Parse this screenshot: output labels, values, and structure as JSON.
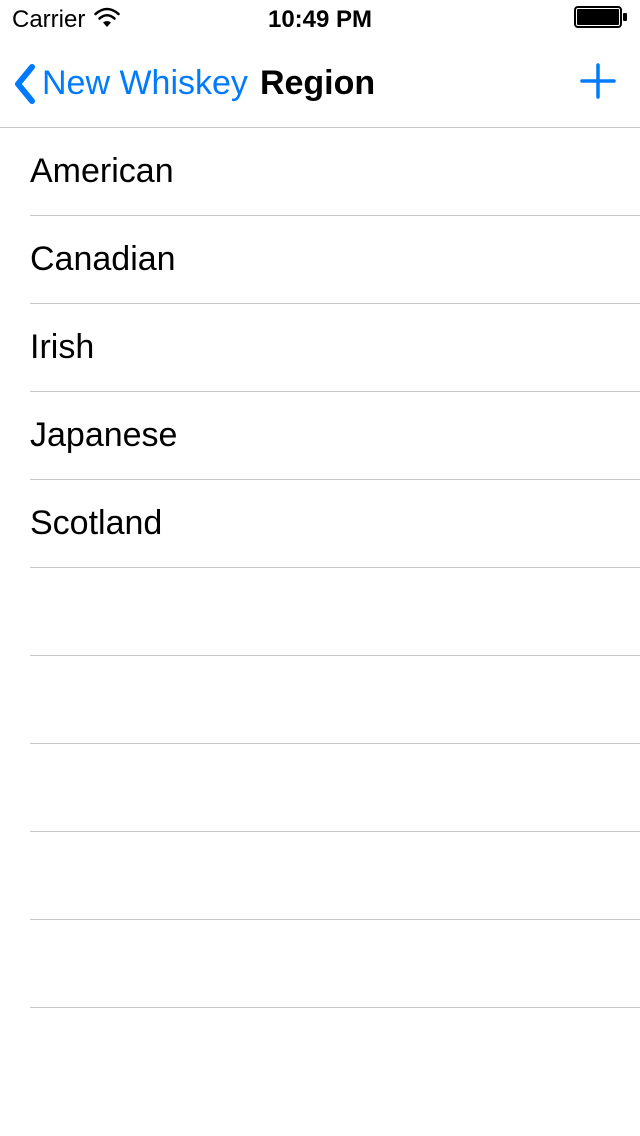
{
  "statusBar": {
    "carrier": "Carrier",
    "time": "10:49 PM"
  },
  "nav": {
    "backLabel": "New Whiskey",
    "title": "Region"
  },
  "list": {
    "items": [
      {
        "label": "American"
      },
      {
        "label": "Canadian"
      },
      {
        "label": "Irish"
      },
      {
        "label": "Japanese"
      },
      {
        "label": "Scotland"
      },
      {
        "label": ""
      },
      {
        "label": ""
      },
      {
        "label": ""
      },
      {
        "label": ""
      },
      {
        "label": ""
      }
    ]
  }
}
